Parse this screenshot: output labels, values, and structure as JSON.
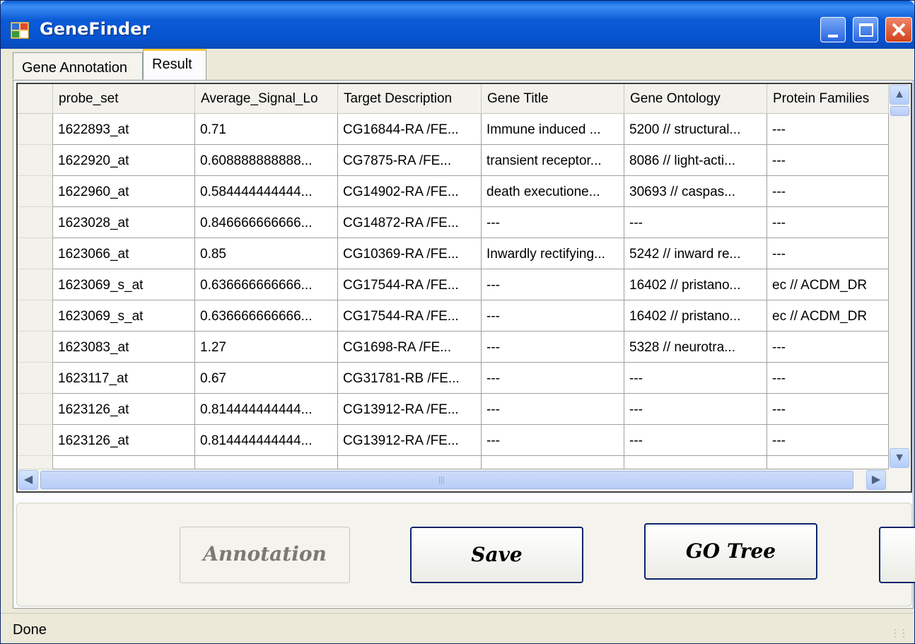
{
  "window": {
    "title": "GeneFinder",
    "icon": "app-grid-icon",
    "controls": [
      "minimize-icon",
      "maximize-icon",
      "close-icon"
    ]
  },
  "tabs": [
    {
      "label": "Gene Annotation",
      "active": false
    },
    {
      "label": "Result",
      "active": true
    }
  ],
  "grid": {
    "columns": [
      "probe_set",
      "Average_Signal_Lo",
      "Target Description",
      "Gene Title",
      "Gene Ontology",
      "Protein Families"
    ],
    "rows": [
      [
        "1622893_at",
        "0.71",
        "CG16844-RA /FE...",
        "Immune induced ...",
        "5200 // structural...",
        "---"
      ],
      [
        "1622920_at",
        "0.608888888888...",
        "CG7875-RA /FE...",
        "transient receptor...",
        "8086 // light-acti...",
        "---"
      ],
      [
        "1622960_at",
        "0.584444444444...",
        "CG14902-RA /FE...",
        "death executione...",
        "30693 // caspas...",
        "---"
      ],
      [
        "1623028_at",
        "0.846666666666...",
        "CG14872-RA /FE...",
        "---",
        "---",
        "---"
      ],
      [
        "1623066_at",
        "0.85",
        "CG10369-RA /FE...",
        "Inwardly rectifying...",
        "5242 // inward re...",
        "---"
      ],
      [
        "1623069_s_at",
        "0.636666666666...",
        "CG17544-RA /FE...",
        "---",
        "16402 // pristano...",
        "ec // ACDM_DR"
      ],
      [
        "1623069_s_at",
        "0.636666666666...",
        "CG17544-RA /FE...",
        "---",
        "16402 // pristano...",
        "ec // ACDM_DR"
      ],
      [
        "1623083_at",
        "1.27",
        "CG1698-RA /FE...",
        "---",
        "5328 // neurotra...",
        "---"
      ],
      [
        "1623117_at",
        "0.67",
        "CG31781-RB /FE...",
        "---",
        "---",
        "---"
      ],
      [
        "1623126_at",
        "0.814444444444...",
        "CG13912-RA /FE...",
        "---",
        "---",
        "---"
      ],
      [
        "1623126_at",
        "0.814444444444...",
        "CG13912-RA /FE...",
        "---",
        "---",
        "---"
      ]
    ]
  },
  "buttons": {
    "annotation": "Annotation",
    "save": "Save",
    "go_tree": "GO Tree"
  },
  "status": {
    "text": "Done"
  },
  "colors": {
    "titlebar": "#0553cf",
    "window_bg": "#ece9d8",
    "button_border": "#0a246a"
  }
}
